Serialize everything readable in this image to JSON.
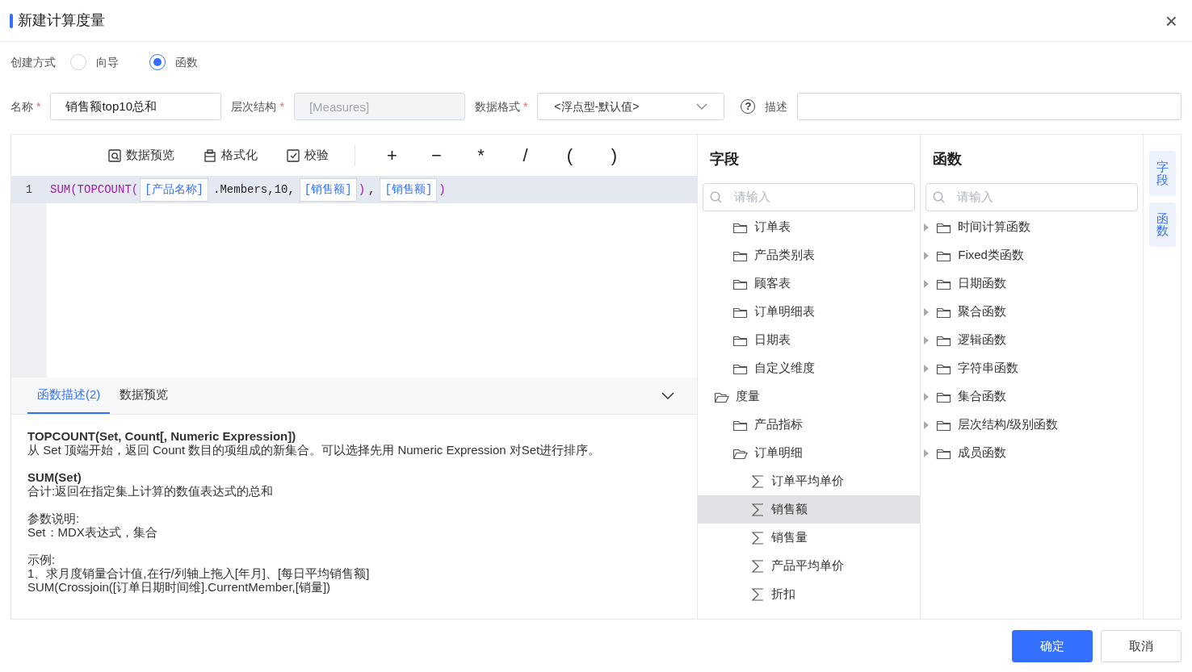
{
  "dialog": {
    "title": "新建计算度量",
    "close": "×"
  },
  "create_mode": {
    "label": "创建方式",
    "options": [
      {
        "label": "向导",
        "selected": false
      },
      {
        "label": "函数",
        "selected": true
      }
    ]
  },
  "form": {
    "name": {
      "label": "名称",
      "mark": "*",
      "value": "销售额top10总和"
    },
    "hierarchy": {
      "label": "层次结构",
      "mark": "*",
      "value": "[Measures]",
      "disabled": true
    },
    "format": {
      "label": "数据格式",
      "mark": "*",
      "value": "<浮点型-默认值>"
    },
    "description": {
      "help": "?",
      "label": "描述"
    }
  },
  "toolbar": {
    "actions": [
      {
        "kind": "preview",
        "label": "数据预览"
      },
      {
        "kind": "format",
        "label": "格式化"
      },
      {
        "kind": "validate",
        "label": "校验"
      }
    ],
    "operators": [
      "+",
      "−",
      "*",
      "/",
      "(",
      ")"
    ]
  },
  "editor": {
    "lines": [
      {
        "number": "1",
        "tokens": [
          {
            "kind": "func",
            "text": "SUM(TOPCOUNT("
          },
          {
            "kind": "field",
            "text": "[产品名称]"
          },
          {
            "kind": "plain",
            "text": ".Members,10,"
          },
          {
            "kind": "field",
            "text": "[销售额]"
          },
          {
            "kind": "func",
            "text": ")"
          },
          {
            "kind": "plain",
            "text": ","
          },
          {
            "kind": "field",
            "text": "[销售额]"
          },
          {
            "kind": "func",
            "text": ")"
          }
        ]
      }
    ]
  },
  "bottom_tabs": [
    {
      "label": "函数描述(2)",
      "selected": true
    },
    {
      "label": "数据预览",
      "selected": false
    }
  ],
  "description_blocks": [
    {
      "title": "TOPCOUNT(Set, Count[, Numeric Expression])",
      "lines": [
        "从 Set 顶端开始，返回 Count 数目的项组成的新集合。可以选择先用 Numeric Expression 对Set进行排序。"
      ]
    },
    {
      "title": "SUM(Set)",
      "lines": [
        "合计:返回在指定集上计算的数值表达式的总和"
      ]
    },
    {
      "lines": [
        "参数说明:",
        "Set：MDX表达式，集合"
      ]
    },
    {
      "lines": [
        "示例:",
        "1、求月度销量合计值,在行/列轴上拖入[年月]、[每日平均销售额]",
        "SUM(Crossjoin([订单日期时间维].CurrentMember,[销量])"
      ]
    }
  ],
  "fields_panel": {
    "title": "字段",
    "search_placeholder": "请输入",
    "tree": [
      {
        "children": [
          {
            "kind": "folder",
            "label": "订单表",
            "selected": false
          },
          {
            "kind": "folder",
            "label": "产品类别表",
            "selected": false
          },
          {
            "kind": "folder",
            "label": "顾客表",
            "selected": false
          },
          {
            "kind": "folder",
            "label": "订单明细表",
            "selected": false
          },
          {
            "kind": "folder",
            "label": "日期表",
            "selected": false
          },
          {
            "kind": "folder",
            "label": "自定义维度",
            "selected": false
          }
        ]
      },
      {
        "kind": "folder",
        "label": "度量",
        "selected": false,
        "expanded": true,
        "children": [
          {
            "kind": "folder",
            "label": "产品指标",
            "selected": false
          },
          {
            "kind": "folder",
            "label": "订单明细",
            "selected": false,
            "expanded": true,
            "children": [
              {
                "kind": "measure",
                "label": "订单平均单价",
                "selected": false
              },
              {
                "kind": "measure",
                "label": "销售额",
                "selected": true
              },
              {
                "kind": "measure",
                "label": "销售量",
                "selected": false
              },
              {
                "kind": "measure",
                "label": "产品平均单价",
                "selected": false
              },
              {
                "kind": "measure",
                "label": "折扣",
                "selected": false
              }
            ]
          }
        ]
      }
    ]
  },
  "functions_panel": {
    "title": "函数",
    "search_placeholder": "请输入",
    "items": [
      {
        "label": "时间计算函数",
        "expanded": false
      },
      {
        "label": "Fixed类函数",
        "expanded": false
      },
      {
        "label": "日期函数",
        "expanded": false
      },
      {
        "label": "聚合函数",
        "expanded": false
      },
      {
        "label": "逻辑函数",
        "expanded": false
      },
      {
        "label": "字符串函数",
        "expanded": false
      },
      {
        "label": "集合函数",
        "expanded": false
      },
      {
        "label": "层次结构/级别函数",
        "expanded": false
      },
      {
        "label": "成员函数",
        "expanded": false
      }
    ]
  },
  "side_tabs": [
    {
      "label": "字段"
    },
    {
      "label": "函数"
    }
  ],
  "buttons": [
    {
      "kind": "primary",
      "label": "确定"
    },
    {
      "kind": "secondary",
      "label": "取消"
    }
  ]
}
